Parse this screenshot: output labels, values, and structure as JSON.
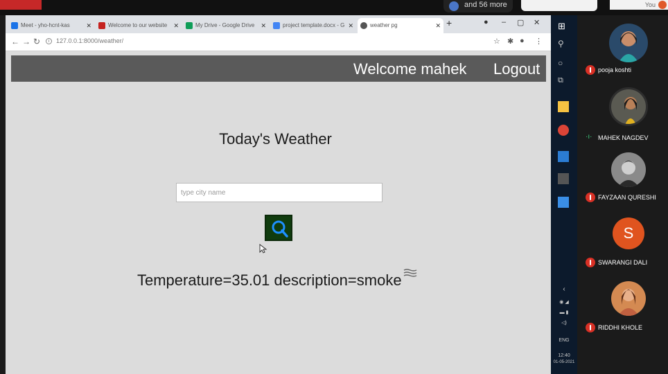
{
  "top_strip": {
    "notice": "and 56 more",
    "you_label": "You"
  },
  "browser": {
    "tabs": [
      {
        "title": "Meet - yho-hcnt-kas",
        "color": "#1a73e8"
      },
      {
        "title": "Welcome to our website",
        "color": "#c5221f"
      },
      {
        "title": "My Drive - Google Drive",
        "color": "#0f9d58"
      },
      {
        "title": "project template.docx - G",
        "color": "#4285f4"
      },
      {
        "title": "weather pg",
        "color": "#555555"
      }
    ],
    "url": "127.0.0.1:8000/weather/"
  },
  "page": {
    "navbar": {
      "welcome": "Welcome mahek",
      "logout": "Logout"
    },
    "heading": "Today's Weather",
    "search": {
      "placeholder": "type city name",
      "value": ""
    },
    "result": "Temperature=35.01 description=smoke",
    "weather_icon": "haze-icon"
  },
  "taskbar": {
    "lang": "ENG",
    "time": "12:40",
    "date": "01-05-2021"
  },
  "participants": [
    {
      "name": "pooja koshti",
      "muted": true
    },
    {
      "name": "MAHEK NAGDEV",
      "muted": false,
      "speaking": true
    },
    {
      "name": "FAYZAAN QURESHI",
      "muted": true
    },
    {
      "name": "SWARANGI DALI",
      "muted": true,
      "initial": "S"
    },
    {
      "name": "RIDDHI KHOLE",
      "muted": true
    }
  ],
  "colors": {
    "navbar": "#5a5a5a",
    "page_bg": "#dcdcdc",
    "search_btn": "#103c0e",
    "search_glyph": "#1e90ff"
  }
}
